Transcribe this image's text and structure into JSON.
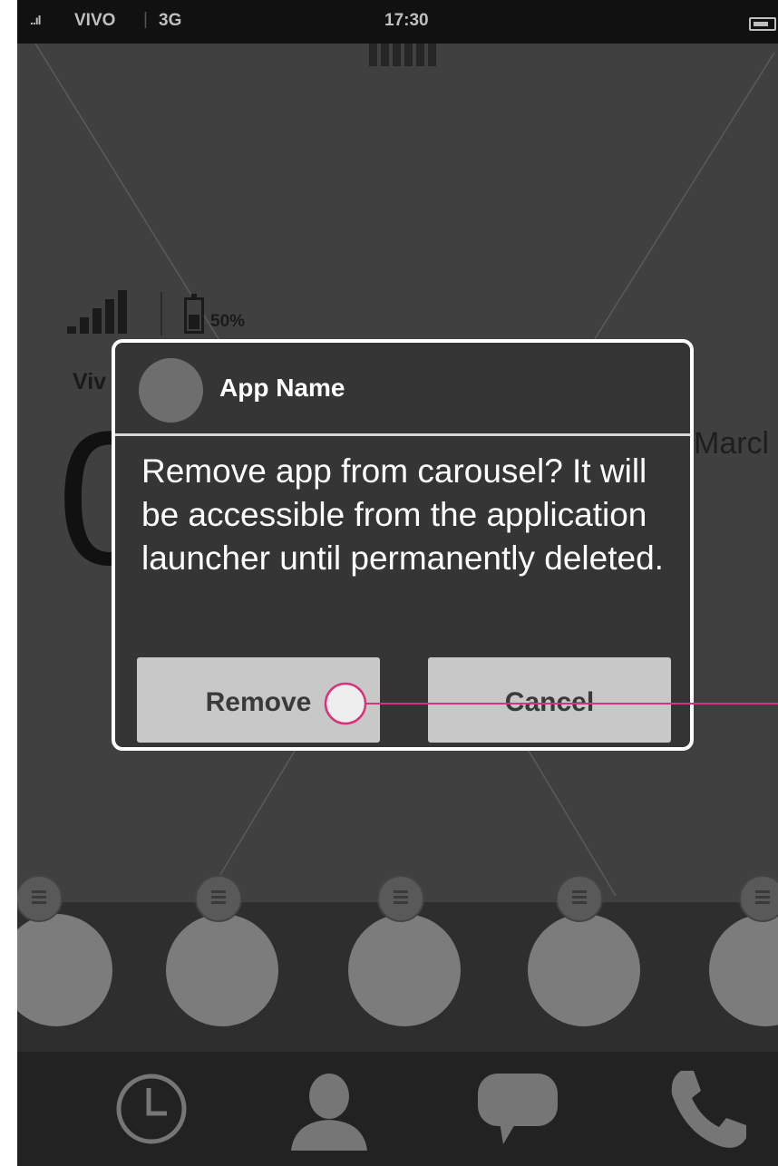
{
  "status_bar": {
    "signal": "..ıl",
    "carrier": "VIVO",
    "separator": "|",
    "network": "3G",
    "time": "17:30"
  },
  "widget": {
    "battery_percent": "50%",
    "carrier_label": "Viv",
    "clock_digit": "0",
    "date_fragment": "Marcl"
  },
  "dialog": {
    "app_name": "App Name",
    "message": "Remove app from carousel? It will be accessible from the application launcher until permanently deleted.",
    "remove_label": "Remove",
    "cancel_label": "Cancel"
  },
  "dock": {
    "apps": [
      "app-1",
      "app-2",
      "app-3",
      "app-4",
      "app-5"
    ]
  },
  "bottom_nav": {
    "items": [
      "clock-icon",
      "contacts-icon",
      "messages-icon",
      "phone-icon"
    ]
  },
  "colors": {
    "background": "#404040",
    "dialog_bg": "#353535",
    "button_bg": "#c8c8c8",
    "annotation": "#d6337a"
  }
}
